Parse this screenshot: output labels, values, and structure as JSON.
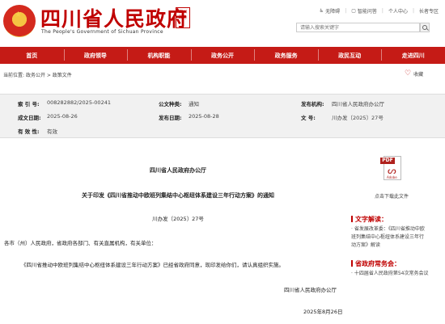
{
  "header": {
    "title": "四川省人民政府",
    "subtitle": "The People's Government of Sichuan Province",
    "seal_text": "四川政务",
    "toplinks": [
      "无障碍",
      "智能问答",
      "个人中心",
      "长者专区"
    ],
    "search_placeholder": "请输入搜索关键字"
  },
  "nav": {
    "items": [
      "首页",
      "政府领导",
      "机构职能",
      "政务公开",
      "政务服务",
      "政民互动",
      "走进四川"
    ]
  },
  "breadcrumb": {
    "label": "当前位置:",
    "path": "政务公开 > 政策文件"
  },
  "favorite_label": "收藏",
  "meta": {
    "index_key": "索 引 号:",
    "index_val": "008282882/2025-00241",
    "type_key": "公文种类:",
    "type_val": "通知",
    "issuer_key": "发布机构:",
    "issuer_val": "四川省人民政府办公厅",
    "made_key": "成文日期:",
    "made_val": "2025-08-26",
    "pub_key": "发布日期:",
    "pub_val": "2025-08-28",
    "docno_key": "文 号:",
    "docno_val": "川办发〔2025〕27号",
    "valid_key": "有 效 性:",
    "valid_val": "有效"
  },
  "doc": {
    "office": "四川省人民政府办公厅",
    "title": "关于印发《四川省推动中欧班列集结中心枢纽体系建设三年行动方案》的通知",
    "number": "川办发〔2025〕27号",
    "recipients": "各市（州）人民政府，省政府各部门、有关直属机构，有关单位：",
    "body": "《四川省推动中欧班列集结中心枢纽体系建设三年行动方案》已经省政府同意，现印发给你们，请认真组织实施。",
    "signer": "四川省人民政府办公厅",
    "date": "2025年8月26日"
  },
  "sidebar": {
    "pdf_tag": "PDF",
    "pdf_brand": "Adobe",
    "pdf_label": "点击下载此文件",
    "interp_title": "文字解读：",
    "interp_line1": "· 省发展改革委：《四川省推动中欧",
    "interp_line2": "班列集结中心枢纽体系建设三年行",
    "interp_line3": "动方案》解读",
    "meeting_title": "省政府常务会：",
    "meeting_line1": "· 十四届省人民政府第54次常务会议"
  }
}
